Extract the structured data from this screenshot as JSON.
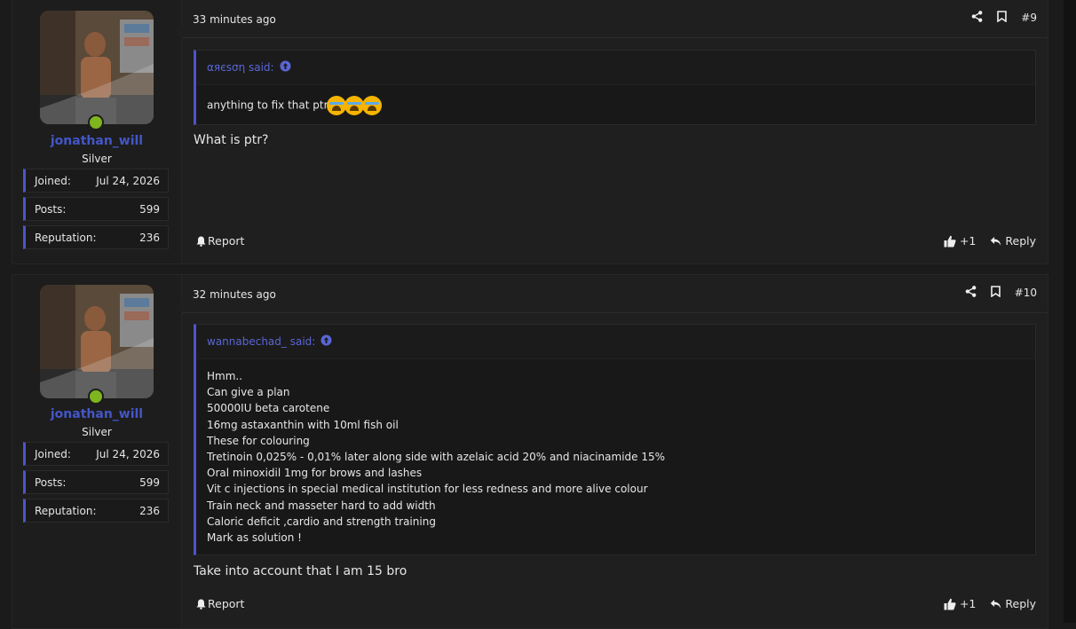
{
  "posts": [
    {
      "user": {
        "name": "jonathan_will",
        "rank": "Silver",
        "stats": [
          {
            "label": "Joined:",
            "value": "Jul 24, 2026"
          },
          {
            "label": "Posts:",
            "value": "599"
          },
          {
            "label": "Reputation:",
            "value": "236"
          }
        ]
      },
      "time": "33 minutes ago",
      "number": "#9",
      "quote": {
        "author": "αяєѕση said:",
        "lines": [
          "anything to fix that ptr"
        ]
      },
      "text": "What is ptr?",
      "report_label": "Report",
      "like_count": "+1",
      "reply_label": "Reply"
    },
    {
      "user": {
        "name": "jonathan_will",
        "rank": "Silver",
        "stats": [
          {
            "label": "Joined:",
            "value": "Jul 24, 2026"
          },
          {
            "label": "Posts:",
            "value": "599"
          },
          {
            "label": "Reputation:",
            "value": "236"
          }
        ]
      },
      "time": "32 minutes ago",
      "number": "#10",
      "quote": {
        "author": "wannabechad_ said:",
        "lines": [
          "Hmm..",
          "Can give a plan",
          "50000IU beta carotene",
          "16mg astaxanthin with 10ml fish oil",
          "These for colouring",
          "Tretinoin 0,025% - 0,01% later along side with azelaic acid 20% and niacinamide 15%",
          "Oral minoxidil 1mg for brows and lashes",
          "Vit c injections in special medical institution for less redness and more alive colour",
          "Train neck and masseter hard to add width",
          "Caloric deficit ,cardio and strength training",
          "Mark as solution !"
        ]
      },
      "text": "Take into account that I am 15 bro",
      "report_label": "Report",
      "like_count": "+1",
      "reply_label": "Reply"
    }
  ],
  "colors": {
    "accent": "#4b55c9",
    "username": "#4356c9",
    "online": "#7fb51e"
  }
}
